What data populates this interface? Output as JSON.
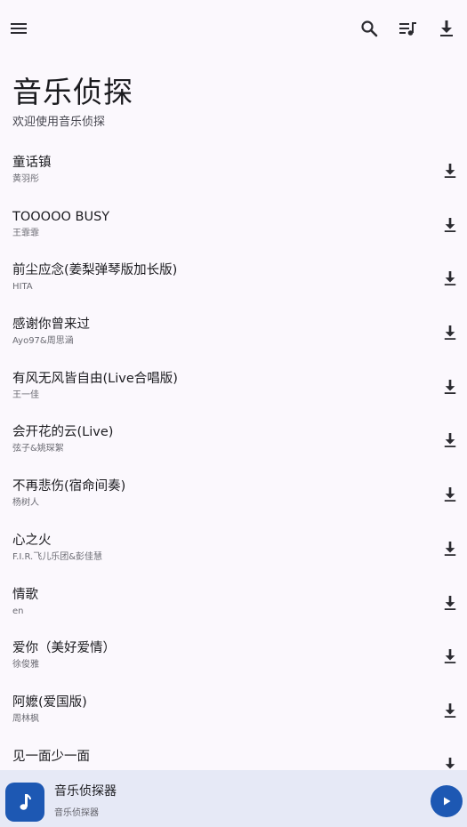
{
  "app": {
    "title": "音乐侦探",
    "subtitle": "欢迎使用音乐侦探"
  },
  "toolbar": {
    "menu_icon": "menu-icon",
    "search_icon": "search-icon",
    "queue_icon": "playlist-music-icon",
    "download_icon": "download-icon"
  },
  "songs": [
    {
      "title": "童话镇",
      "artist": "黄羽彤"
    },
    {
      "title": "TOOOOO BUSY",
      "artist": "王霏霏"
    },
    {
      "title": "前尘应念(姜梨弹琴版加长版)",
      "artist": "HITA"
    },
    {
      "title": "感谢你曾来过",
      "artist": "Ayo97&周思涵"
    },
    {
      "title": "有风无风皆自由(Live合唱版)",
      "artist": "王一佳"
    },
    {
      "title": "会开花的云(Live)",
      "artist": "弦子&姚琛絮"
    },
    {
      "title": "不再悲伤(宿命间奏)",
      "artist": "杨树人"
    },
    {
      "title": "心之火",
      "artist": "F.I.R.飞儿乐团&彭佳慧"
    },
    {
      "title": "情歌",
      "artist": "en"
    },
    {
      "title": "爱你（美好爱情）",
      "artist": "徐俊雅"
    },
    {
      "title": "阿嬷(爱国版)",
      "artist": "周林枫"
    },
    {
      "title": "见一面少一面",
      "artist": ""
    }
  ],
  "player": {
    "title": "音乐侦探器",
    "subtitle": "音乐侦探器",
    "art_icon": "music-note-icon",
    "play_icon": "play-icon"
  },
  "colors": {
    "background": "#fbf8fd",
    "player_bar": "#e6e9f6",
    "accent": "#1d58b3",
    "text_primary": "#1b1b1f",
    "text_secondary": "#6b6b73"
  }
}
